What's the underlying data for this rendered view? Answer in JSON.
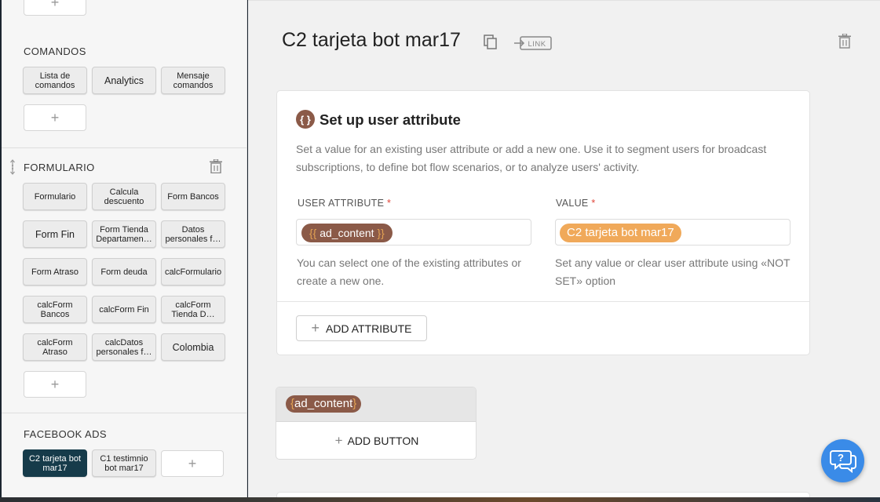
{
  "sidebar": {
    "comandos": {
      "title": "COMANDOS",
      "buttons": [
        "Lista de comandos",
        "Analytics",
        "Mensaje comandos"
      ],
      "add_label": "+"
    },
    "formulario": {
      "title": "FORMULARIO",
      "buttons": [
        "Formulario",
        "Calcula descuento",
        "Form Bancos",
        "Form Fin",
        "Form Tienda Departamen…",
        "Datos personales f…",
        "Form Atraso",
        "Form deuda",
        "calcFormulario",
        "calcForm Bancos",
        "calcForm Fin",
        "calcForm Tienda D…",
        "calcForm Atraso",
        "calcDatos personales f…",
        "Colombia"
      ],
      "add_label": "+"
    },
    "facebook_ads": {
      "title": "FACEBOOK ADS",
      "buttons": [
        "C2 tarjeta bot mar17",
        "C1 testimnio bot mar17"
      ],
      "add_label": "+"
    },
    "top_add_label": "+"
  },
  "main": {
    "title": "C2 tarjeta bot mar17",
    "link_label": "LINK",
    "card": {
      "icon_text": "{ }",
      "title": "Set up user attribute",
      "description": "Set a value for an existing user attribute or add a new one. Use it to segment users for broadcast subscriptions, to define bot flow scenarios, or to analyze users' activity.",
      "attribute_label": "USER ATTRIBUTE",
      "value_label": "VALUE",
      "required_mark": "*",
      "attribute_value": "ad_content",
      "brace_open": "{{",
      "brace_close": "}}",
      "value_value": "C2 tarjeta bot mar17",
      "attribute_hint": "You can select one of the existing attributes or create a new one.",
      "value_hint": "Set any value or clear user attribute using «NOT SET» option",
      "add_attribute_label": "ADD ATTRIBUTE"
    },
    "text_card": {
      "chip_open": "{",
      "chip_text": "ad_content",
      "chip_close": "}",
      "add_button_label": "ADD BUTTON"
    }
  },
  "colors": {
    "attribute_chip": "#8b5a48",
    "value_chip": "#f0a95a",
    "active_block": "#163b4a",
    "help_button": "#3a8be8",
    "required": "#e0463a"
  }
}
